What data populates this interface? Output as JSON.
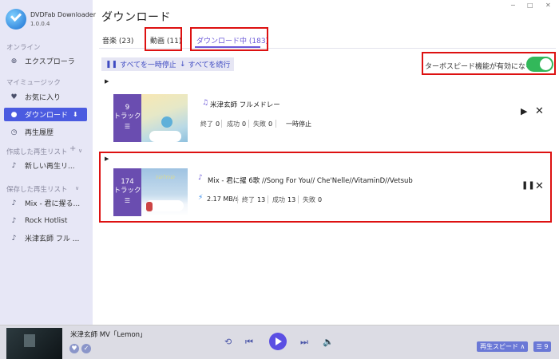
{
  "app": {
    "name": "DVDFab Downloader",
    "version": "1.0.0.4"
  },
  "window_controls": {
    "minimize": "−",
    "maximize": "□",
    "close": "✕"
  },
  "sidebar": {
    "sections": {
      "online": "オンライン",
      "my_music": "マイミュージック",
      "created_playlists": "作成した再生リスト",
      "saved_playlists": "保存した再生リスト"
    },
    "items": {
      "explorer": "エクスプローラ",
      "favorites": "お気に入り",
      "download": "ダウンロード",
      "history": "再生履歴",
      "new_playlist": "新しい再生リ...",
      "saved1": "Mix - 君に擢る...",
      "saved2": "Rock Hotlist",
      "saved3": "米津玄師 フル ..."
    }
  },
  "header": {
    "title": "ダウンロード"
  },
  "tabs": [
    {
      "label": "音楽 (23)"
    },
    {
      "label": "動画 (11)"
    },
    {
      "label": "ダウンロード中 (183)"
    }
  ],
  "toolbar": {
    "pause_all": "すべてを一時停止",
    "resume_all": "すべてを続行"
  },
  "turbo": {
    "label": "ターボスピード機能が有効になる",
    "enabled": true,
    "color": "#32b85a"
  },
  "downloads": [
    {
      "count": "9",
      "unit": "トラック",
      "title": "米津玄師 フルメドレー",
      "done_label": "終了",
      "done": "0",
      "ok_label": "成功",
      "ok": "0",
      "fail_label": "失敗",
      "fail": "0",
      "status": "一時停止"
    },
    {
      "count": "174",
      "unit": "トラック",
      "title": "Mix - 君に擢 6歌 //Song For You// Che'Nelle//VitaminD//Vetsub",
      "speed": "2.17 MB/s",
      "done_label": "終了",
      "done": "13",
      "ok_label": "成功",
      "ok": "13",
      "fail_label": "失敗",
      "fail": "0"
    }
  ],
  "player": {
    "song": "米津玄師 MV「Lemon」",
    "speed_button": "再生スピード ∧",
    "queue_count": "9"
  },
  "colors": {
    "accent": "#4b5be0",
    "highlight_border": "#dd1111",
    "purple": "#6a57d8"
  }
}
